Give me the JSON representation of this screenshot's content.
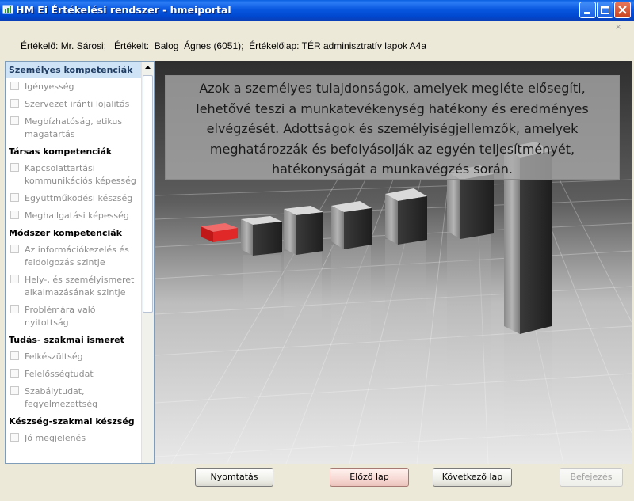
{
  "window": {
    "title": "HM Ei Értékelési rendszer - hmeiportal"
  },
  "info_line": "Értékelő: Mr. Sárosi;   Értékelt:  Balog  Ágnes (6051);  Értékelőlap: TÉR adminisztratív lapok A4a",
  "sidebar": {
    "groups": [
      {
        "title": "Személyes kompetenciák",
        "selected": true,
        "items": [
          "Igényesség",
          "Szervezet iránti lojalitás",
          "Megbízhatóság, etikus magatartás"
        ]
      },
      {
        "title": "Társas kompetenciák",
        "items": [
          "Kapcsolattartási kommunikációs képesség",
          "Együttműködési készség",
          "Meghallgatási képesség"
        ]
      },
      {
        "title": "Módszer kompetenciák",
        "items": [
          "Az információkezelés és feldolgozás szintje",
          "Hely-, és személyismeret alkalmazásának szintje",
          "Problémára való nyitottság"
        ]
      },
      {
        "title": "Tudás- szakmai ismeret",
        "items": [
          "Felkészültség",
          "Felelősségtudat",
          "Szabálytudat, fegyelmezettség"
        ]
      },
      {
        "title": "Készség-szakmai készség",
        "items": [
          "Jó megjelenés"
        ]
      }
    ]
  },
  "main": {
    "caption": "Azok a személyes tulajdonságok, amelyek megléte elősegíti, lehetővé teszi a munkatevékenység hatékony és eredményes elvégzését. Adottságok és személyiségjellemzők, amelyek meghatározzák és befolyásolják az egyén teljesítményét, hatékonyságát a munkavégzés során."
  },
  "buttons": {
    "print": "Nyomtatás",
    "prev": "Előző lap",
    "next": "Következő lap",
    "finish": "Befejezés"
  },
  "icons": [
    "app-icon",
    "minimize-icon",
    "maximize-icon",
    "close-icon",
    "scroll-up-arrow-icon",
    "small-close-icon"
  ],
  "colors": {
    "titlebar": "#0A5FE0",
    "selected_category": "#CFE3F7",
    "highlight_bar": "#D42A2A",
    "prev_button_hover": "#F7D9D4"
  }
}
